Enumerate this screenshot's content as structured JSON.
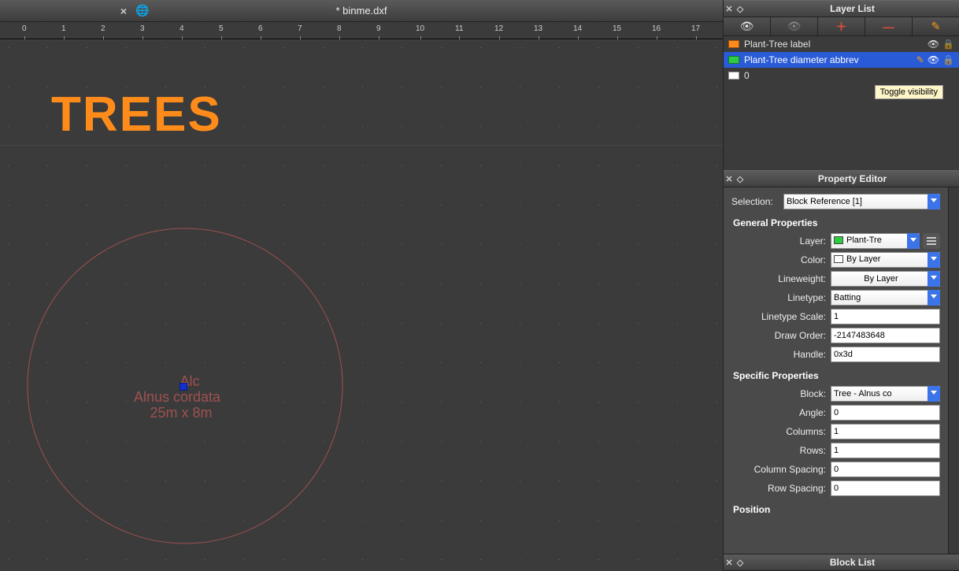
{
  "titlebar": {
    "filename": "* binme.dxf",
    "close": "×"
  },
  "ruler": {
    "ticks": [
      "0",
      "1",
      "2",
      "3",
      "4",
      "5",
      "6",
      "7",
      "8",
      "9",
      "10",
      "11",
      "12",
      "13",
      "14",
      "15",
      "16",
      "17"
    ]
  },
  "canvas": {
    "title": "TREES",
    "tree_abbrev": "Alc",
    "tree_label_line1": "Alnus cordata",
    "tree_label_line2": "25m x 8m"
  },
  "layer_panel": {
    "title": "Layer List",
    "toolbar_icons": [
      "eye-on",
      "eye-off",
      "plus",
      "minus",
      "pencil"
    ],
    "rows": [
      {
        "name": "0",
        "selected": false,
        "color": "#ffffff",
        "icons": [
          "",
          ""
        ]
      },
      {
        "name": "Plant-Tree diameter abbrev",
        "selected": true,
        "color": "#2ecc40",
        "icons": [
          "pencil",
          "eye",
          "lock"
        ]
      },
      {
        "name": "Plant-Tree label",
        "selected": false,
        "color": "#ff8c1a",
        "icons": [
          "eye",
          "lock"
        ]
      }
    ],
    "tooltip": "Toggle visibility"
  },
  "prop_panel": {
    "title": "Property Editor",
    "selection_label": "Selection:",
    "selection_value": "Block Reference [1]",
    "general_title": "General Properties",
    "general": {
      "layer_label": "Layer:",
      "layer_value": "Plant-Tre",
      "color_label": "Color:",
      "color_value": "By Layer",
      "lineweight_label": "Lineweight:",
      "lineweight_value": "By Layer",
      "linetype_label": "Linetype:",
      "linetype_value": "Batting",
      "linetypescale_label": "Linetype Scale:",
      "linetypescale_value": "1",
      "draworder_label": "Draw Order:",
      "draworder_value": "-2147483648",
      "handle_label": "Handle:",
      "handle_value": "0x3d"
    },
    "specific_title": "Specific Properties",
    "specific": {
      "block_label": "Block:",
      "block_value": "Tree - Alnus co",
      "angle_label": "Angle:",
      "angle_value": "0",
      "columns_label": "Columns:",
      "columns_value": "1",
      "rows_label": "Rows:",
      "rows_value": "1",
      "colspacing_label": "Column Spacing:",
      "colspacing_value": "0",
      "rowspacing_label": "Row Spacing:",
      "rowspacing_value": "0"
    },
    "position_title": "Position"
  },
  "block_panel": {
    "title": "Block List"
  }
}
